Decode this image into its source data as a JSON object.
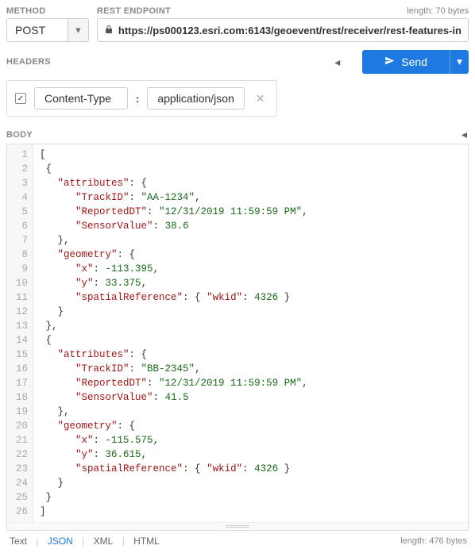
{
  "labels": {
    "method": "METHOD",
    "endpoint": "REST ENDPOINT",
    "headers": "HEADERS",
    "body": "BODY"
  },
  "method": {
    "value": "POST"
  },
  "endpoint": {
    "url": "https://ps000123.esri.com:6143/geoevent/rest/receiver/rest-features-in",
    "length_text": "length: 70 bytes"
  },
  "send": {
    "label": "Send"
  },
  "header_row": {
    "checked": true,
    "key": "Content-Type",
    "value": "application/json"
  },
  "editor_lines": [
    {
      "n": 1,
      "t": [
        [
          "p",
          "["
        ]
      ]
    },
    {
      "n": 2,
      "t": [
        [
          "p",
          " {"
        ]
      ]
    },
    {
      "n": 3,
      "t": [
        [
          "p",
          "   "
        ],
        [
          "k",
          "\"attributes\""
        ],
        [
          "p",
          ": {"
        ]
      ]
    },
    {
      "n": 4,
      "t": [
        [
          "p",
          "      "
        ],
        [
          "k",
          "\"TrackID\""
        ],
        [
          "p",
          ": "
        ],
        [
          "s",
          "\"AA-1234\""
        ],
        [
          "p",
          ","
        ]
      ]
    },
    {
      "n": 5,
      "t": [
        [
          "p",
          "      "
        ],
        [
          "k",
          "\"ReportedDT\""
        ],
        [
          "p",
          ": "
        ],
        [
          "s",
          "\"12/31/2019 11:59:59 PM\""
        ],
        [
          "p",
          ","
        ]
      ]
    },
    {
      "n": 6,
      "t": [
        [
          "p",
          "      "
        ],
        [
          "k",
          "\"SensorValue\""
        ],
        [
          "p",
          ": "
        ],
        [
          "n",
          "38.6"
        ]
      ]
    },
    {
      "n": 7,
      "t": [
        [
          "p",
          "   },"
        ]
      ]
    },
    {
      "n": 8,
      "t": [
        [
          "p",
          "   "
        ],
        [
          "k",
          "\"geometry\""
        ],
        [
          "p",
          ": {"
        ]
      ]
    },
    {
      "n": 9,
      "t": [
        [
          "p",
          "      "
        ],
        [
          "k",
          "\"x\""
        ],
        [
          "p",
          ": "
        ],
        [
          "n",
          "-113.395"
        ],
        [
          "p",
          ","
        ]
      ]
    },
    {
      "n": 10,
      "t": [
        [
          "p",
          "      "
        ],
        [
          "k",
          "\"y\""
        ],
        [
          "p",
          ": "
        ],
        [
          "n",
          "33.375"
        ],
        [
          "p",
          ","
        ]
      ]
    },
    {
      "n": 11,
      "t": [
        [
          "p",
          "      "
        ],
        [
          "k",
          "\"spatialReference\""
        ],
        [
          "p",
          ": { "
        ],
        [
          "k",
          "\"wkid\""
        ],
        [
          "p",
          ": "
        ],
        [
          "n",
          "4326"
        ],
        [
          "p",
          " }"
        ]
      ]
    },
    {
      "n": 12,
      "t": [
        [
          "p",
          "   }"
        ]
      ]
    },
    {
      "n": 13,
      "t": [
        [
          "p",
          " },"
        ]
      ]
    },
    {
      "n": 14,
      "t": [
        [
          "p",
          " {"
        ]
      ]
    },
    {
      "n": 15,
      "t": [
        [
          "p",
          "   "
        ],
        [
          "k",
          "\"attributes\""
        ],
        [
          "p",
          ": {"
        ]
      ]
    },
    {
      "n": 16,
      "t": [
        [
          "p",
          "      "
        ],
        [
          "k",
          "\"TrackID\""
        ],
        [
          "p",
          ": "
        ],
        [
          "s",
          "\"BB-2345\""
        ],
        [
          "p",
          ","
        ]
      ]
    },
    {
      "n": 17,
      "t": [
        [
          "p",
          "      "
        ],
        [
          "k",
          "\"ReportedDT\""
        ],
        [
          "p",
          ": "
        ],
        [
          "s",
          "\"12/31/2019 11:59:59 PM\""
        ],
        [
          "p",
          ","
        ]
      ]
    },
    {
      "n": 18,
      "t": [
        [
          "p",
          "      "
        ],
        [
          "k",
          "\"SensorValue\""
        ],
        [
          "p",
          ": "
        ],
        [
          "n",
          "41.5"
        ]
      ]
    },
    {
      "n": 19,
      "t": [
        [
          "p",
          "   },"
        ]
      ]
    },
    {
      "n": 20,
      "t": [
        [
          "p",
          "   "
        ],
        [
          "k",
          "\"geometry\""
        ],
        [
          "p",
          ": {"
        ]
      ]
    },
    {
      "n": 21,
      "t": [
        [
          "p",
          "      "
        ],
        [
          "k",
          "\"x\""
        ],
        [
          "p",
          ": "
        ],
        [
          "n",
          "-115.575"
        ],
        [
          "p",
          ","
        ]
      ]
    },
    {
      "n": 22,
      "t": [
        [
          "p",
          "      "
        ],
        [
          "k",
          "\"y\""
        ],
        [
          "p",
          ": "
        ],
        [
          "n",
          "36.615"
        ],
        [
          "p",
          ","
        ]
      ]
    },
    {
      "n": 23,
      "t": [
        [
          "p",
          "      "
        ],
        [
          "k",
          "\"spatialReference\""
        ],
        [
          "p",
          ": { "
        ],
        [
          "k",
          "\"wkid\""
        ],
        [
          "p",
          ": "
        ],
        [
          "n",
          "4326"
        ],
        [
          "p",
          " }"
        ]
      ]
    },
    {
      "n": 24,
      "t": [
        [
          "p",
          "   }"
        ]
      ]
    },
    {
      "n": 25,
      "t": [
        [
          "p",
          " }"
        ]
      ]
    },
    {
      "n": 26,
      "t": [
        [
          "p",
          "]"
        ]
      ]
    }
  ],
  "footer": {
    "formats": {
      "text": "Text",
      "json": "JSON",
      "xml": "XML",
      "html": "HTML"
    },
    "length_text": "length: 476 bytes"
  }
}
